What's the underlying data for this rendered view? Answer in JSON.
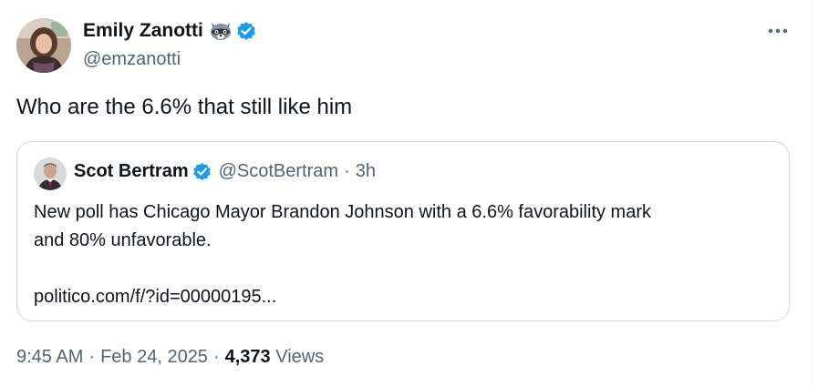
{
  "tweet": {
    "author": {
      "name": "Emily Zanotti",
      "handle": "@emzanotti",
      "emoji_icon": "raccoon-icon",
      "verified": true
    },
    "text": "Who are the 6.6% that still like him",
    "quote": {
      "author": {
        "name": "Scot Bertram",
        "handle": "@ScotBertram",
        "verified": true
      },
      "separator": "·",
      "time": "3h",
      "body_lines": [
        "New poll has Chicago Mayor Brandon Johnson with a 6.6% favorability mark",
        "and 80% unfavorable."
      ],
      "link": "politico.com/f/?id=00000195..."
    },
    "meta": {
      "time": "9:45 AM",
      "separator": "·",
      "date": "Feb 24, 2025",
      "views_count": "4,373",
      "views_label": "Views"
    }
  },
  "colors": {
    "text_primary": "#0f1419",
    "text_secondary": "#536471",
    "verified_blue": "#1d9bf0",
    "border": "#cfd9de"
  }
}
